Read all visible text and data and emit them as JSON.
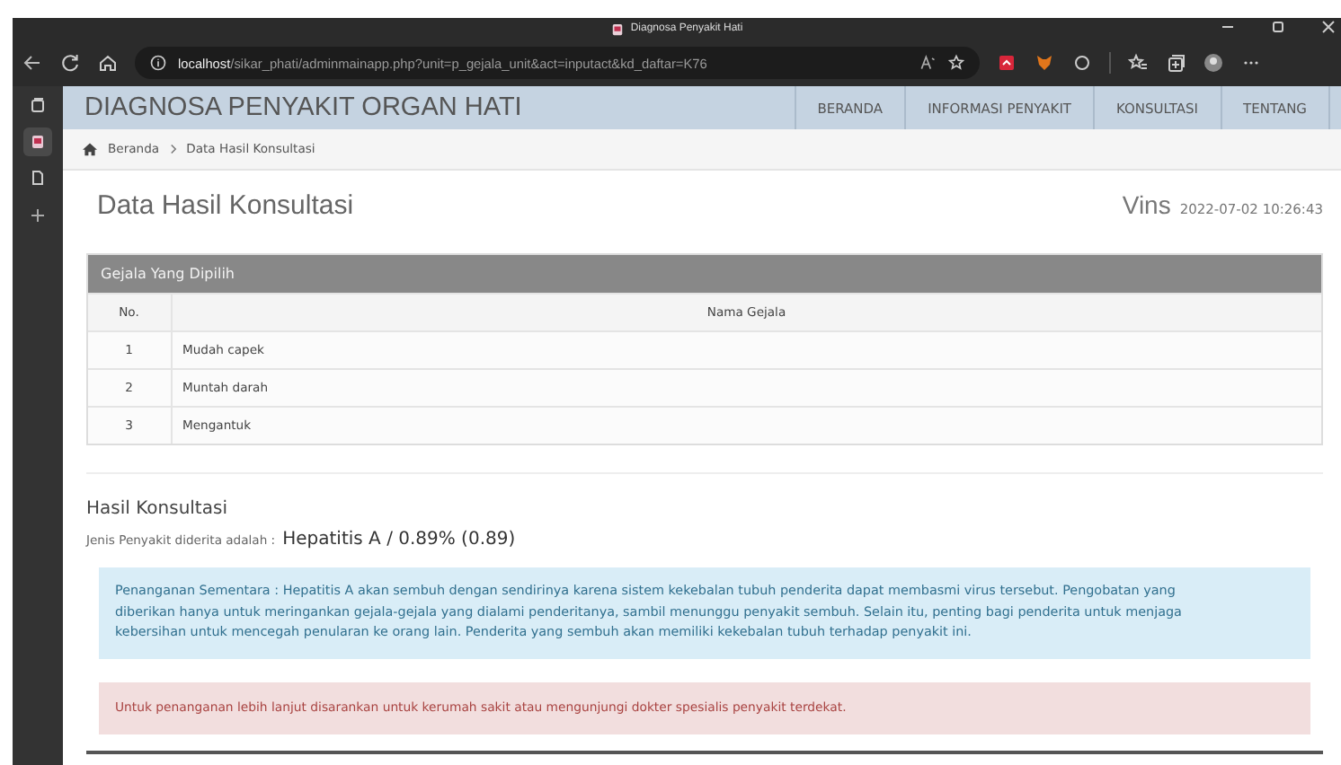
{
  "browser": {
    "title": "Diagnosa Penyakit Hati",
    "url_host": "localhost",
    "url_path": "/sikar_phati/adminmainapp.php?unit=p_gejala_unit&act=inputact&kd_daftar=K76"
  },
  "vertical_tabs": [
    {
      "kind": "tab-actions",
      "selected": false
    },
    {
      "kind": "favicon",
      "selected": true
    },
    {
      "kind": "page",
      "selected": false
    }
  ],
  "navbar": {
    "brand": "DIAGNOSA PENYAKIT ORGAN HATI",
    "items": [
      {
        "label": "BERANDA",
        "selected": false
      },
      {
        "label": "INFORMASI PENYAKIT",
        "selected": false
      },
      {
        "label": "KONSULTASI",
        "selected": false
      },
      {
        "label": "TENTANG",
        "selected": false
      }
    ]
  },
  "breadcrumb": [
    "Beranda",
    "Data Hasil Konsultasi"
  ],
  "page_title": "Data Hasil Konsultasi",
  "user": "Vins",
  "timestamp": "2022-07-02 10:26:43",
  "symptoms": {
    "title": "Gejala Yang Dipilih",
    "columns": [
      "No.",
      "Nama Gejala"
    ],
    "rows": [
      [
        "1",
        "Mudah capek"
      ],
      [
        "2",
        "Muntah darah"
      ],
      [
        "3",
        "Mengantuk"
      ]
    ]
  },
  "result": {
    "title": "Hasil Konsultasi",
    "label": "Jenis Penyakit diderita adalah :",
    "value": "Hepatitis A / 0.89% (0.89)"
  },
  "alerts": [
    {
      "kind": "info",
      "text": "Penanganan Sementara : Hepatitis A akan sembuh dengan sendirinya karena sistem kekebalan tubuh penderita dapat membasmi virus tersebut. Pengobatan yang diberikan hanya untuk meringankan gejala-gejala yang dialami penderitanya, sambil menunggu penyakit sembuh. Selain itu, penting bagi penderita untuk menjaga kebersihan untuk mencegah penularan ke orang lain. Penderita yang sembuh akan memiliki kekebalan tubuh terhadap penyakit ini."
    },
    {
      "kind": "danger",
      "text": "Untuk penanganan lebih lanjut disarankan untuk kerumah sakit atau mengunjungi dokter spesialis penyakit terdekat."
    }
  ]
}
